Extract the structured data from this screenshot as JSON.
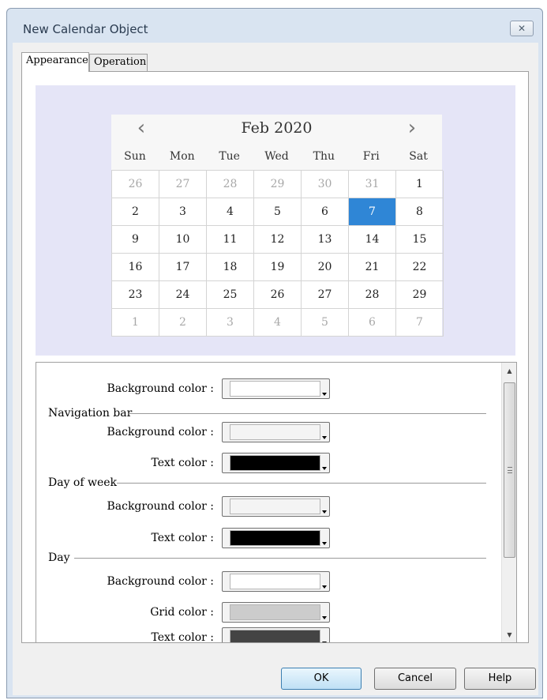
{
  "window": {
    "title": "New Calendar Object",
    "close_glyph": "✕"
  },
  "tabs": [
    {
      "label": "Appearance",
      "active": true
    },
    {
      "label": "Operation",
      "active": false
    }
  ],
  "calendar": {
    "month_label": "Feb 2020",
    "prev_glyph": "‹",
    "next_glyph": "›",
    "weekdays": [
      "Sun",
      "Mon",
      "Tue",
      "Wed",
      "Thu",
      "Fri",
      "Sat"
    ],
    "weeks": [
      [
        "26",
        "27",
        "28",
        "29",
        "30",
        "31",
        "1"
      ],
      [
        "2",
        "3",
        "4",
        "5",
        "6",
        "7",
        "8"
      ],
      [
        "9",
        "10",
        "11",
        "12",
        "13",
        "14",
        "15"
      ],
      [
        "16",
        "17",
        "18",
        "19",
        "20",
        "21",
        "22"
      ],
      [
        "23",
        "24",
        "25",
        "26",
        "27",
        "28",
        "29"
      ],
      [
        "1",
        "2",
        "3",
        "4",
        "5",
        "6",
        "7"
      ]
    ],
    "selected_day": "7",
    "colors": {
      "selected": "#2f86d6",
      "preview_background": "#e5e5f7",
      "outside_month_text": "#a8a8a8"
    }
  },
  "properties": {
    "background_color_label": "Background color :",
    "background_color_value": "#ffffff",
    "navigation_bar": {
      "heading": "Navigation bar",
      "background_label": "Background color :",
      "background_value": "#f4f4f4",
      "text_label": "Text color :",
      "text_value": "#000000"
    },
    "day_of_week": {
      "heading": "Day of week",
      "background_label": "Background color :",
      "background_value": "#f4f4f4",
      "text_label": "Text color :",
      "text_value": "#000000"
    },
    "day": {
      "heading": "Day",
      "background_label": "Background color :",
      "background_value": "#ffffff",
      "grid_label": "Grid color :",
      "grid_value": "#cccccc",
      "text_label": "Text color :",
      "text_value": "#444444"
    }
  },
  "scrollbar": {
    "up_glyph": "▲",
    "down_glyph": "▼"
  },
  "buttons": {
    "ok": "OK",
    "cancel": "Cancel",
    "help": "Help"
  }
}
